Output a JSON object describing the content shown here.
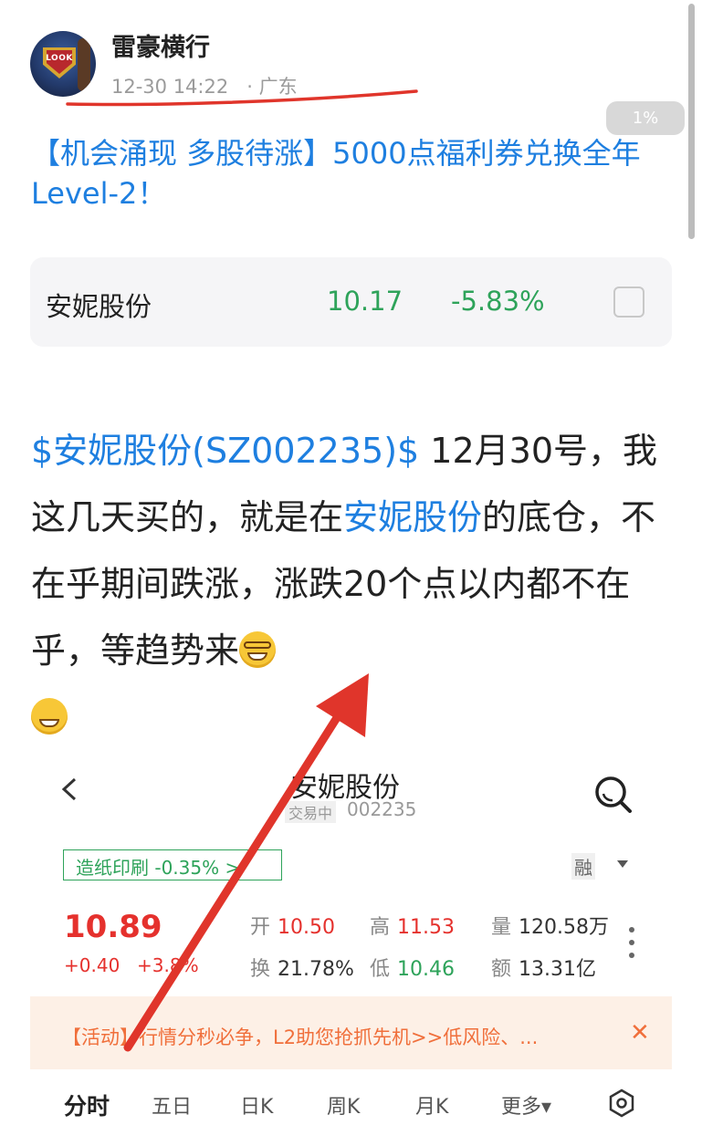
{
  "post_header": {
    "username": "雷豪横行",
    "datetime": "12-30 14:22",
    "location": "· 广东",
    "avatar_text": "LOOK"
  },
  "scroll_indicator": "1%",
  "headline": "【机会涌现 多股待涨】5000点福利券兑换全年Level-2！",
  "stock_card": {
    "name": "安妮股份",
    "price": "10.17",
    "change": "-5.83%"
  },
  "post_body": {
    "tag": "$安妮股份(SZ002235)$",
    "text1": " 12月30号，我这几天买的，就是在",
    "link": "安妮股份",
    "text2": "的底仓，不在乎期间跌涨，涨跌20个点以内都不在乎，等趋势来"
  },
  "app_screenshot": {
    "title": "安妮股份",
    "status": "交易中",
    "code": "002235",
    "sector": "造纸印刷 -0.35%",
    "rong": "融",
    "price": "10.89",
    "change_abs": "+0.40",
    "change_pct": "+3.8%",
    "open_label": "开",
    "open": "10.50",
    "high_label": "高",
    "high": "11.53",
    "volume_label": "量",
    "volume": "120.58万",
    "turnover_label": "换",
    "turnover": "21.78%",
    "low_label": "低",
    "low": "10.46",
    "amount_label": "额",
    "amount": "13.31亿",
    "banner": "【活动】行情分秒必争，L2助您抢抓先机>>低风险、...",
    "tabs": [
      "分时",
      "五日",
      "日K",
      "周K",
      "月K",
      "更多▾"
    ]
  },
  "colors": {
    "link_blue": "#1e7fe0",
    "down_green": "#2ea35a",
    "up_red": "#e5312d",
    "banner_orange": "#f06f3b",
    "annotation_red": "#e0352b"
  }
}
